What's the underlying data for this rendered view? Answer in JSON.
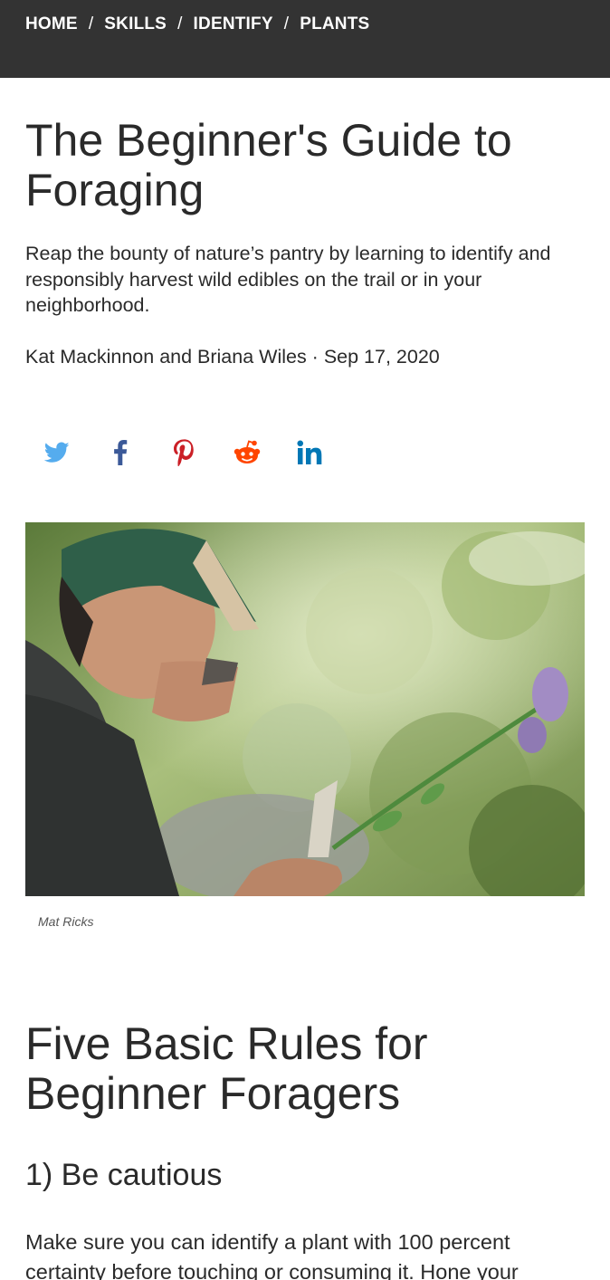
{
  "breadcrumb": {
    "items": [
      "HOME",
      "SKILLS",
      "IDENTIFY",
      "PLANTS"
    ],
    "separator": "/"
  },
  "article": {
    "title": "The Beginner's Guide to Foraging",
    "dek": "Reap the bounty of nature’s pantry by learning to identify and responsibly harvest wild edibles on the trail or in your neighborhood.",
    "byline": "Kat Mackinnon and Briana Wiles · Sep 17, 2020",
    "photo_credit": "Mat Ricks",
    "section_heading": "Five Basic Rules for Beginner Foragers",
    "rule_heading": "1) Be cautious",
    "body": "Make sure you can identify a plant with 100 percent certainty before touching or consuming it. Hone your"
  },
  "share": {
    "icons": [
      "twitter-icon",
      "facebook-icon",
      "pinterest-icon",
      "reddit-icon",
      "linkedin-icon"
    ],
    "colors": {
      "twitter": "#55acee",
      "facebook": "#3b5998",
      "pinterest": "#cb2027",
      "reddit": "#ff4500",
      "linkedin": "#0077b5"
    }
  },
  "colors": {
    "topbar": "#333333",
    "text": "#2a2a2a"
  }
}
